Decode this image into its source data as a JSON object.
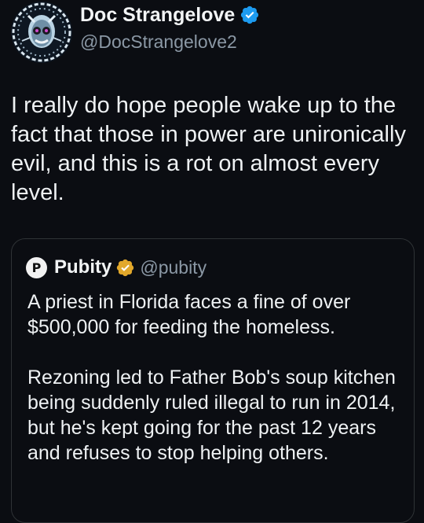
{
  "tweet": {
    "author": {
      "display_name": "Doc Strangelove",
      "handle": "@DocStrangelove2",
      "verified": true,
      "verified_color": "#1d9bf0",
      "avatar_icon": "avatar-illustration"
    },
    "text": "I really do hope people wake up to the fact that those in power are unironically evil, and this is a rot on almost every level."
  },
  "quote": {
    "author": {
      "display_name": "Pubity",
      "handle": "@pubity",
      "verified": true,
      "badge_color": "#e2a82b",
      "avatar_letter": "P"
    },
    "paragraphs": [
      "A priest in Florida faces a fine of over $500,000 for feeding the homeless.",
      "Rezoning led to Father Bob's soup kitchen being suddenly ruled illegal to run in 2014, but he's kept going for the past 12 years and refuses to stop helping others."
    ]
  },
  "theme": {
    "background": "#0b0d12",
    "text": "#e7e9ea",
    "secondary_text": "#8b98a5",
    "border": "#2f3336"
  }
}
